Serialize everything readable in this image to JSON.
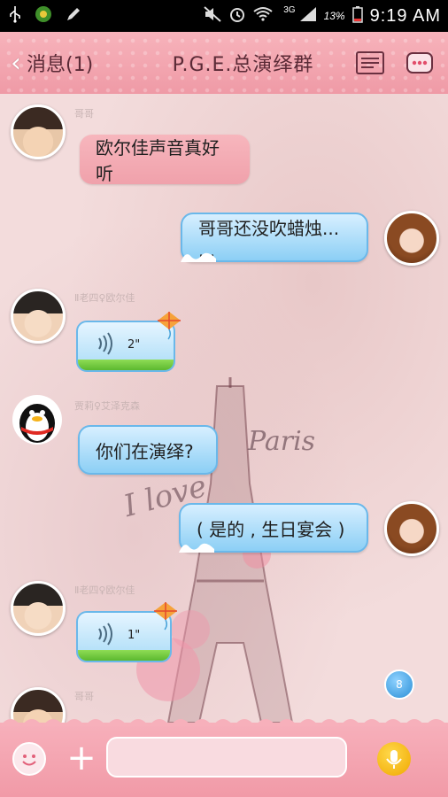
{
  "status_bar": {
    "network": "3G",
    "battery_percent": "13%",
    "time": "9:19 AM"
  },
  "title_bar": {
    "back_label": "消息(1)",
    "title": "P.G.E.总演绎群"
  },
  "messages": [
    {
      "sender": "哥哥",
      "text": "欧尔佳声音真好听"
    },
    {
      "text": "哥哥还没吹蜡烛... ..."
    },
    {
      "sender": "Ⅱ老四♀欧尔佳",
      "voice_duration": "2\""
    },
    {
      "sender": "贾莉♀艾泽克森",
      "text": "你们在演绎?"
    },
    {
      "text": "( 是的 , 生日宴会 )"
    },
    {
      "sender": "Ⅱ老四♀欧尔佳",
      "voice_duration": "1\""
    },
    {
      "sender": "哥哥"
    }
  ],
  "background_text": {
    "line1": "Paris",
    "line2": "I love"
  },
  "new_message_badge": "8",
  "colors": {
    "accent_pink": "#f19aa7",
    "bubble_blue": "#8ccff5",
    "mic_yellow": "#f0a800"
  }
}
